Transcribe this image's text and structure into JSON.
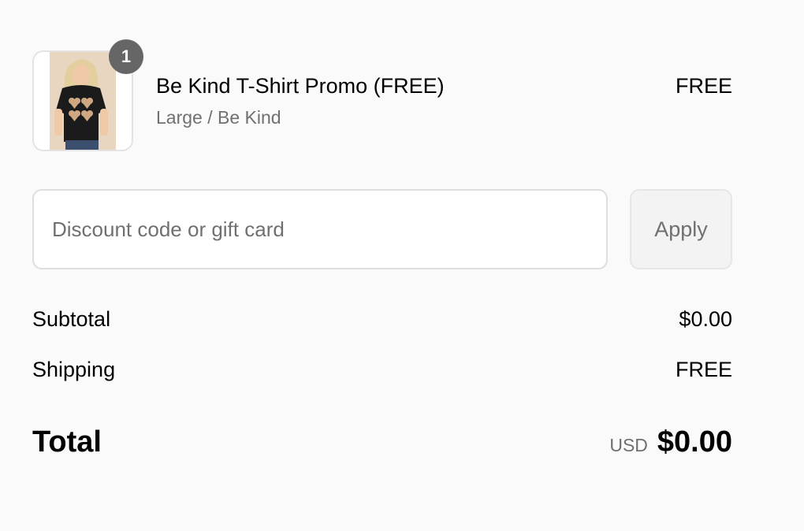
{
  "order_summary": {
    "line_item": {
      "quantity": "1",
      "title": "Be Kind T-Shirt Promo (FREE)",
      "variant": "Large / Be Kind",
      "price": "FREE",
      "image_icon": "product-photo-tshirt"
    },
    "discount": {
      "placeholder": "Discount code or gift card",
      "value": "",
      "apply_label": "Apply"
    },
    "subtotal": {
      "label": "Subtotal",
      "value": "$0.00"
    },
    "shipping": {
      "label": "Shipping",
      "value": "FREE"
    },
    "total": {
      "label": "Total",
      "currency": "USD",
      "amount": "$0.00"
    }
  },
  "colors": {
    "background": "#fafafa",
    "text": "#000000",
    "muted_text": "#707070",
    "badge": "#666666"
  }
}
